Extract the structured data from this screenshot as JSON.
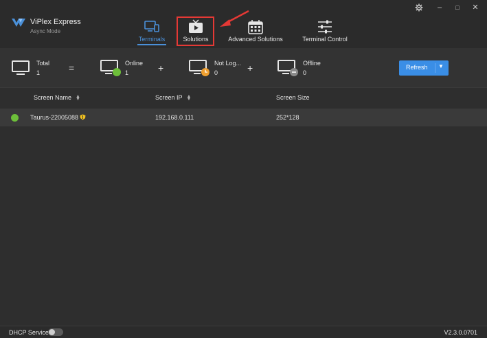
{
  "app": {
    "title": "ViPlex Express",
    "subtitle": "Async Mode"
  },
  "window_controls": {
    "settings_icon": "gear-icon",
    "minimize": "–",
    "maximize": "□",
    "close": "✕"
  },
  "nav": [
    {
      "label": "Terminals",
      "icon": "monitor-tablet-icon",
      "active": true
    },
    {
      "label": "Solutions",
      "icon": "tv-play-icon",
      "active": false
    },
    {
      "label": "Advanced Solutions",
      "icon": "calendar-icon",
      "active": false
    },
    {
      "label": "Terminal Control",
      "icon": "sliders-icon",
      "active": false
    }
  ],
  "stats": {
    "total": {
      "label": "Total",
      "value": "1"
    },
    "equals": "=",
    "online": {
      "label": "Online",
      "value": "1"
    },
    "plus1": "+",
    "not_logged": {
      "label": "Not Log...",
      "value": "0"
    },
    "plus2": "+",
    "offline": {
      "label": "Offline",
      "value": "0"
    }
  },
  "refresh": {
    "label": "Refresh",
    "caret": "▼"
  },
  "table": {
    "columns": [
      "Screen Name",
      "Screen IP",
      "Screen Size"
    ],
    "rows": [
      {
        "name": "Taurus-22005088",
        "ip": "192.168.0.111",
        "size": "252*128",
        "status": "online"
      }
    ]
  },
  "footer": {
    "dhcp_label": "DHCP Service",
    "dhcp_enabled": false,
    "version": "V2.3.0.0701"
  },
  "colors": {
    "accent": "#3a8ee6",
    "active_tab": "#4a90d9",
    "online": "#6dbf3a",
    "not_logged": "#f0a030",
    "annotation": "#e53935"
  }
}
